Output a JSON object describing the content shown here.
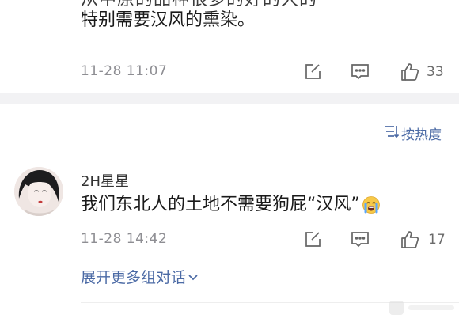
{
  "previous_comment": {
    "cut_text": "从中原的品种很多的好的大的",
    "text_line": "特别需要汉风的熏染。",
    "time": "11-28 11:07",
    "like_count": "33"
  },
  "sort": {
    "label": "按热度",
    "icon": "sort-lines-icon"
  },
  "comment": {
    "username": "2H星星",
    "text": "我们东北人的土地不需要狗屁“汉风”",
    "emoji": "crying-face-emoji",
    "time": "11-28 14:42",
    "like_count": "17"
  },
  "expand": {
    "label": "展开更多组对话",
    "icon": "chevron-down-icon"
  },
  "colors": {
    "link": "#4b6aa5",
    "meta_text": "#8e8e93",
    "divider": "#f2f2f4",
    "icon_stroke": "#666666"
  },
  "icons": [
    "edit-icon",
    "comment-icon",
    "thumbs-up-icon"
  ]
}
